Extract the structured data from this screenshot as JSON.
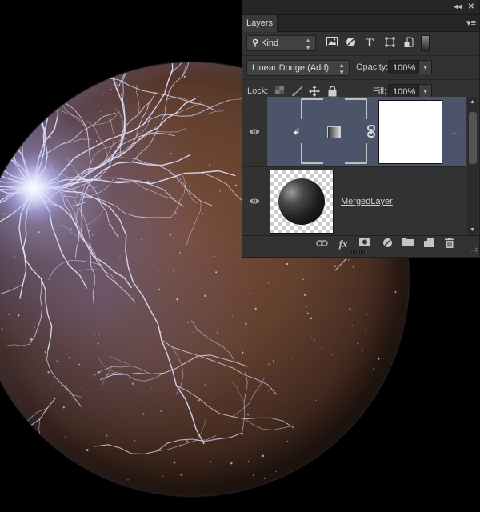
{
  "canvas": {
    "subject": "planet-with-lightning",
    "colors": {
      "background": "#000000",
      "planet_base": "#64402f",
      "lightning": "#e6e8ff",
      "flare": "#ffffff"
    }
  },
  "panel": {
    "title_controls": {
      "collapse_icon": "double-chevron-left-icon",
      "collapse_glyph": "◂◂",
      "close_icon": "close-icon",
      "close_glyph": "✕"
    },
    "tab_label": "Layers",
    "menu_glyph": "▾≡",
    "filter": {
      "kind_label": "Kind",
      "search_glyph": "⚲",
      "icons": [
        {
          "name": "pixel-layer-filter-icon",
          "glyph": "🖼"
        },
        {
          "name": "adjustment-layer-filter-icon",
          "glyph": "◑"
        },
        {
          "name": "type-layer-filter-icon",
          "glyph": "T"
        },
        {
          "name": "shape-layer-filter-icon",
          "glyph": "⬚"
        },
        {
          "name": "smart-object-filter-icon",
          "glyph": "❐"
        }
      ]
    },
    "blend": {
      "mode": "Linear Dodge (Add)",
      "opacity_label": "Opacity:",
      "opacity_value": "100%"
    },
    "lock": {
      "label": "Lock:",
      "icons": [
        {
          "name": "lock-transparent-pixels-icon",
          "glyph": "▦"
        },
        {
          "name": "lock-image-pixels-icon",
          "glyph": "🖌"
        },
        {
          "name": "lock-position-icon",
          "glyph": "✥"
        },
        {
          "name": "lock-all-icon",
          "glyph": "🔒"
        }
      ],
      "fill_label": "Fill:",
      "fill_value": "100%"
    },
    "layers": [
      {
        "type": "gradient-map-adjustment",
        "visible": true,
        "selected": true,
        "name": "",
        "clipped": true,
        "linked_mask": true,
        "more_glyph": "..."
      },
      {
        "type": "pixel",
        "visible": true,
        "selected": false,
        "name": "MergedLayer"
      }
    ],
    "footer_icons": [
      {
        "name": "link-layers-icon",
        "glyph": "⊂⊃"
      },
      {
        "name": "layer-style-fx-icon",
        "glyph": "fx"
      },
      {
        "name": "add-mask-icon",
        "glyph": "◙"
      },
      {
        "name": "new-adjustment-layer-icon",
        "glyph": "◐"
      },
      {
        "name": "new-group-folder-icon",
        "glyph": "▬"
      },
      {
        "name": "new-layer-icon",
        "glyph": "◪"
      },
      {
        "name": "delete-layer-trash-icon",
        "glyph": "🗑"
      }
    ],
    "colors": {
      "panel_bg": "#323232",
      "selected_row": "#4b5468",
      "titlebar": "#262626"
    }
  }
}
